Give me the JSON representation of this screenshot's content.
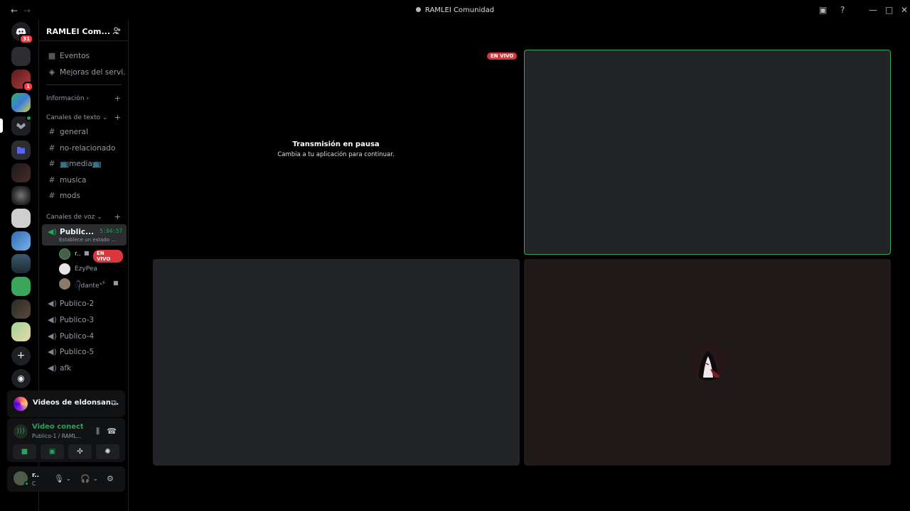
{
  "window": {
    "title": "RAMLEI Comunidad",
    "back_label": "←",
    "forward_label": "→",
    "controls": [
      "—",
      "□",
      "✕"
    ]
  },
  "rail": {
    "dm_badge": "31",
    "server_badge": "1",
    "add_server": "+",
    "discover": "◉"
  },
  "server": {
    "name": "RAMLEI Com...",
    "chevron": "⌄",
    "invite": "👤+"
  },
  "sidebar": {
    "events": "Eventos",
    "boosts": "Mejoras del servi...",
    "info_category": "Información",
    "text_category": "Canales de texto",
    "voice_category": "Canales de voz",
    "text_channels": [
      "general",
      "no-relacionado",
      "📺media📺",
      "musica",
      "mods"
    ],
    "active_voice": {
      "name": "Public...",
      "timer": "5:04:57",
      "status": "Establece un estado ..."
    },
    "members": [
      {
        "name": "r..",
        "live": "EN VIVO"
      },
      {
        "name": "EzyPea"
      },
      {
        "name": "᭄dante°"
      }
    ],
    "voice_channels": [
      "Publico-2",
      "Publico-3",
      "Publico-4",
      "Publico-5",
      "afk"
    ]
  },
  "activity": {
    "title": "Videos de eldonsan...",
    "icon": "⧉"
  },
  "voice_panel": {
    "status": "Video conectado",
    "channel": "Publico-1 / RAML..."
  },
  "user": {
    "name": "r..",
    "sub": "C"
  },
  "stage": {
    "live_label": "EN VIVO",
    "paused_title": "Transmisión en pausa",
    "paused_sub": "Cambia a tu aplicación para continuar."
  },
  "colors": {
    "accent_green": "#23a55a",
    "live_red": "#da373c",
    "tile_bg": "#232428"
  }
}
